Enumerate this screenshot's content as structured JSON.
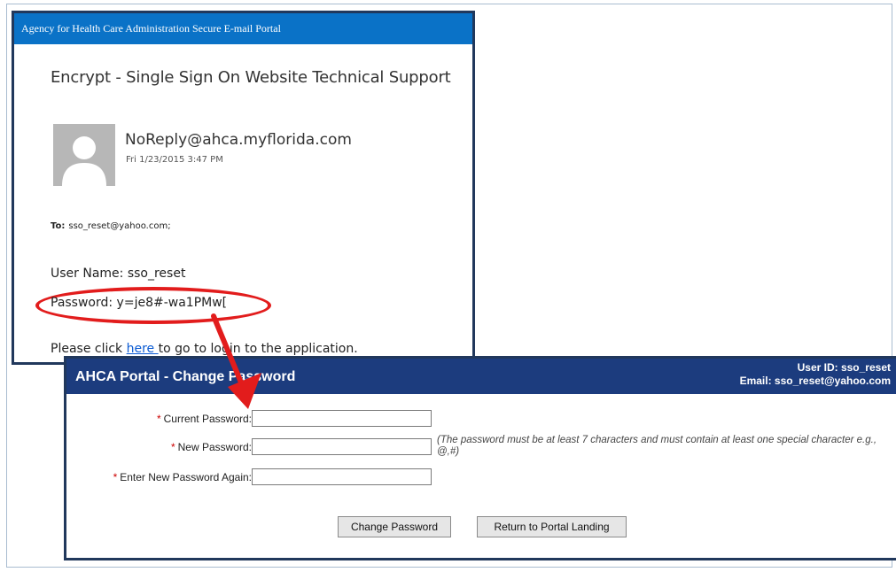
{
  "email": {
    "portal_header": "Agency for Health Care Administration Secure E-mail Portal",
    "subject": "Encrypt - Single Sign On Website Technical Support",
    "sender": "NoReply@ahca.myflorida.com",
    "sent": "Fri 1/23/2015 3:47 PM",
    "to_label": "To:",
    "to_value": "sso_reset@yahoo.com;",
    "username_line": "User Name: sso_reset",
    "password_line": "Password: y=je8#-wa1PMw[",
    "click_prefix": "Please click ",
    "click_link": "here ",
    "click_suffix": "to go to login to the application."
  },
  "change_password": {
    "title": "AHCA Portal - Change Password",
    "user_id": "User ID: sso_reset",
    "email": "Email: sso_reset@yahoo.com",
    "required_mark": "*",
    "current_label": "Current Password:",
    "new_label": "New Password:",
    "again_label": "Enter New Password Again:",
    "hint": "(The password must be at least 7 characters and must contain at least one special character e.g., @,#)",
    "change_button": "Change Password",
    "return_button": "Return to Portal Landing"
  },
  "colors": {
    "email_header": "#0a72c7",
    "panel_header": "#1c3c7e",
    "annotation": "#e21c1c",
    "link": "#0b5bd3"
  }
}
